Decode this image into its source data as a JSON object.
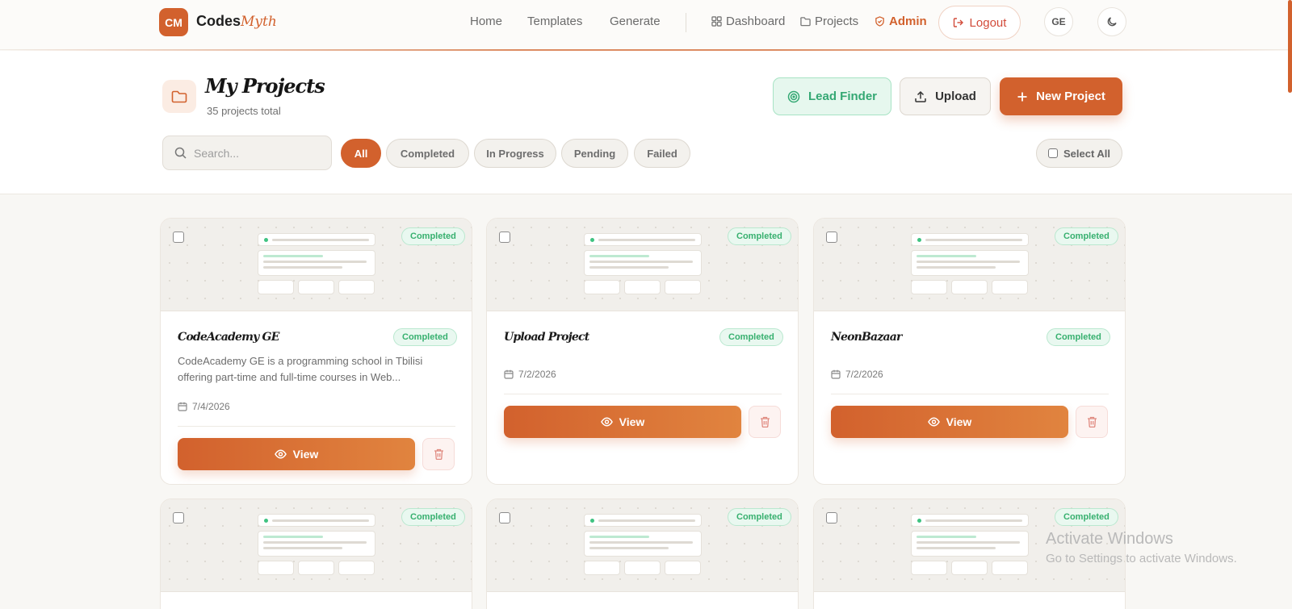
{
  "brand": {
    "badge": "CM",
    "name": "Codes",
    "name_accent": "Myth"
  },
  "nav": {
    "links": [
      "Home",
      "Templates",
      "Generate"
    ],
    "dashboard": "Dashboard",
    "projects": "Projects",
    "admin": "Admin",
    "logout": "Logout",
    "language": "GE"
  },
  "page": {
    "title": "My Projects",
    "subtitle": "35 projects total",
    "lead_finder": "Lead Finder",
    "upload": "Upload",
    "new_project": "New Project"
  },
  "search": {
    "placeholder": "Search..."
  },
  "filters": [
    "All",
    "Completed",
    "In Progress",
    "Pending",
    "Failed"
  ],
  "select_all": "Select All",
  "cards": [
    {
      "title": "CodeAcademy GE",
      "status": "Completed",
      "description": "CodeAcademy GE is a programming school in Tbilisi offering part-time and full-time courses in Web...",
      "date": "7/4/2026",
      "view": "View"
    },
    {
      "title": "Upload Project",
      "status": "Completed",
      "description": "",
      "date": "7/2/2026",
      "view": "View"
    },
    {
      "title": "NeonBazaar",
      "status": "Completed",
      "description": "",
      "date": "7/2/2026",
      "view": "View"
    },
    {
      "status": "Completed"
    },
    {
      "status": "Completed"
    },
    {
      "status": "Completed"
    }
  ],
  "watermark": {
    "line1": "Activate Windows",
    "line2": "Go to Settings to activate Windows."
  },
  "colors": {
    "accent": "#d2612d",
    "success": "#37b06f",
    "danger": "#d24b3a"
  }
}
